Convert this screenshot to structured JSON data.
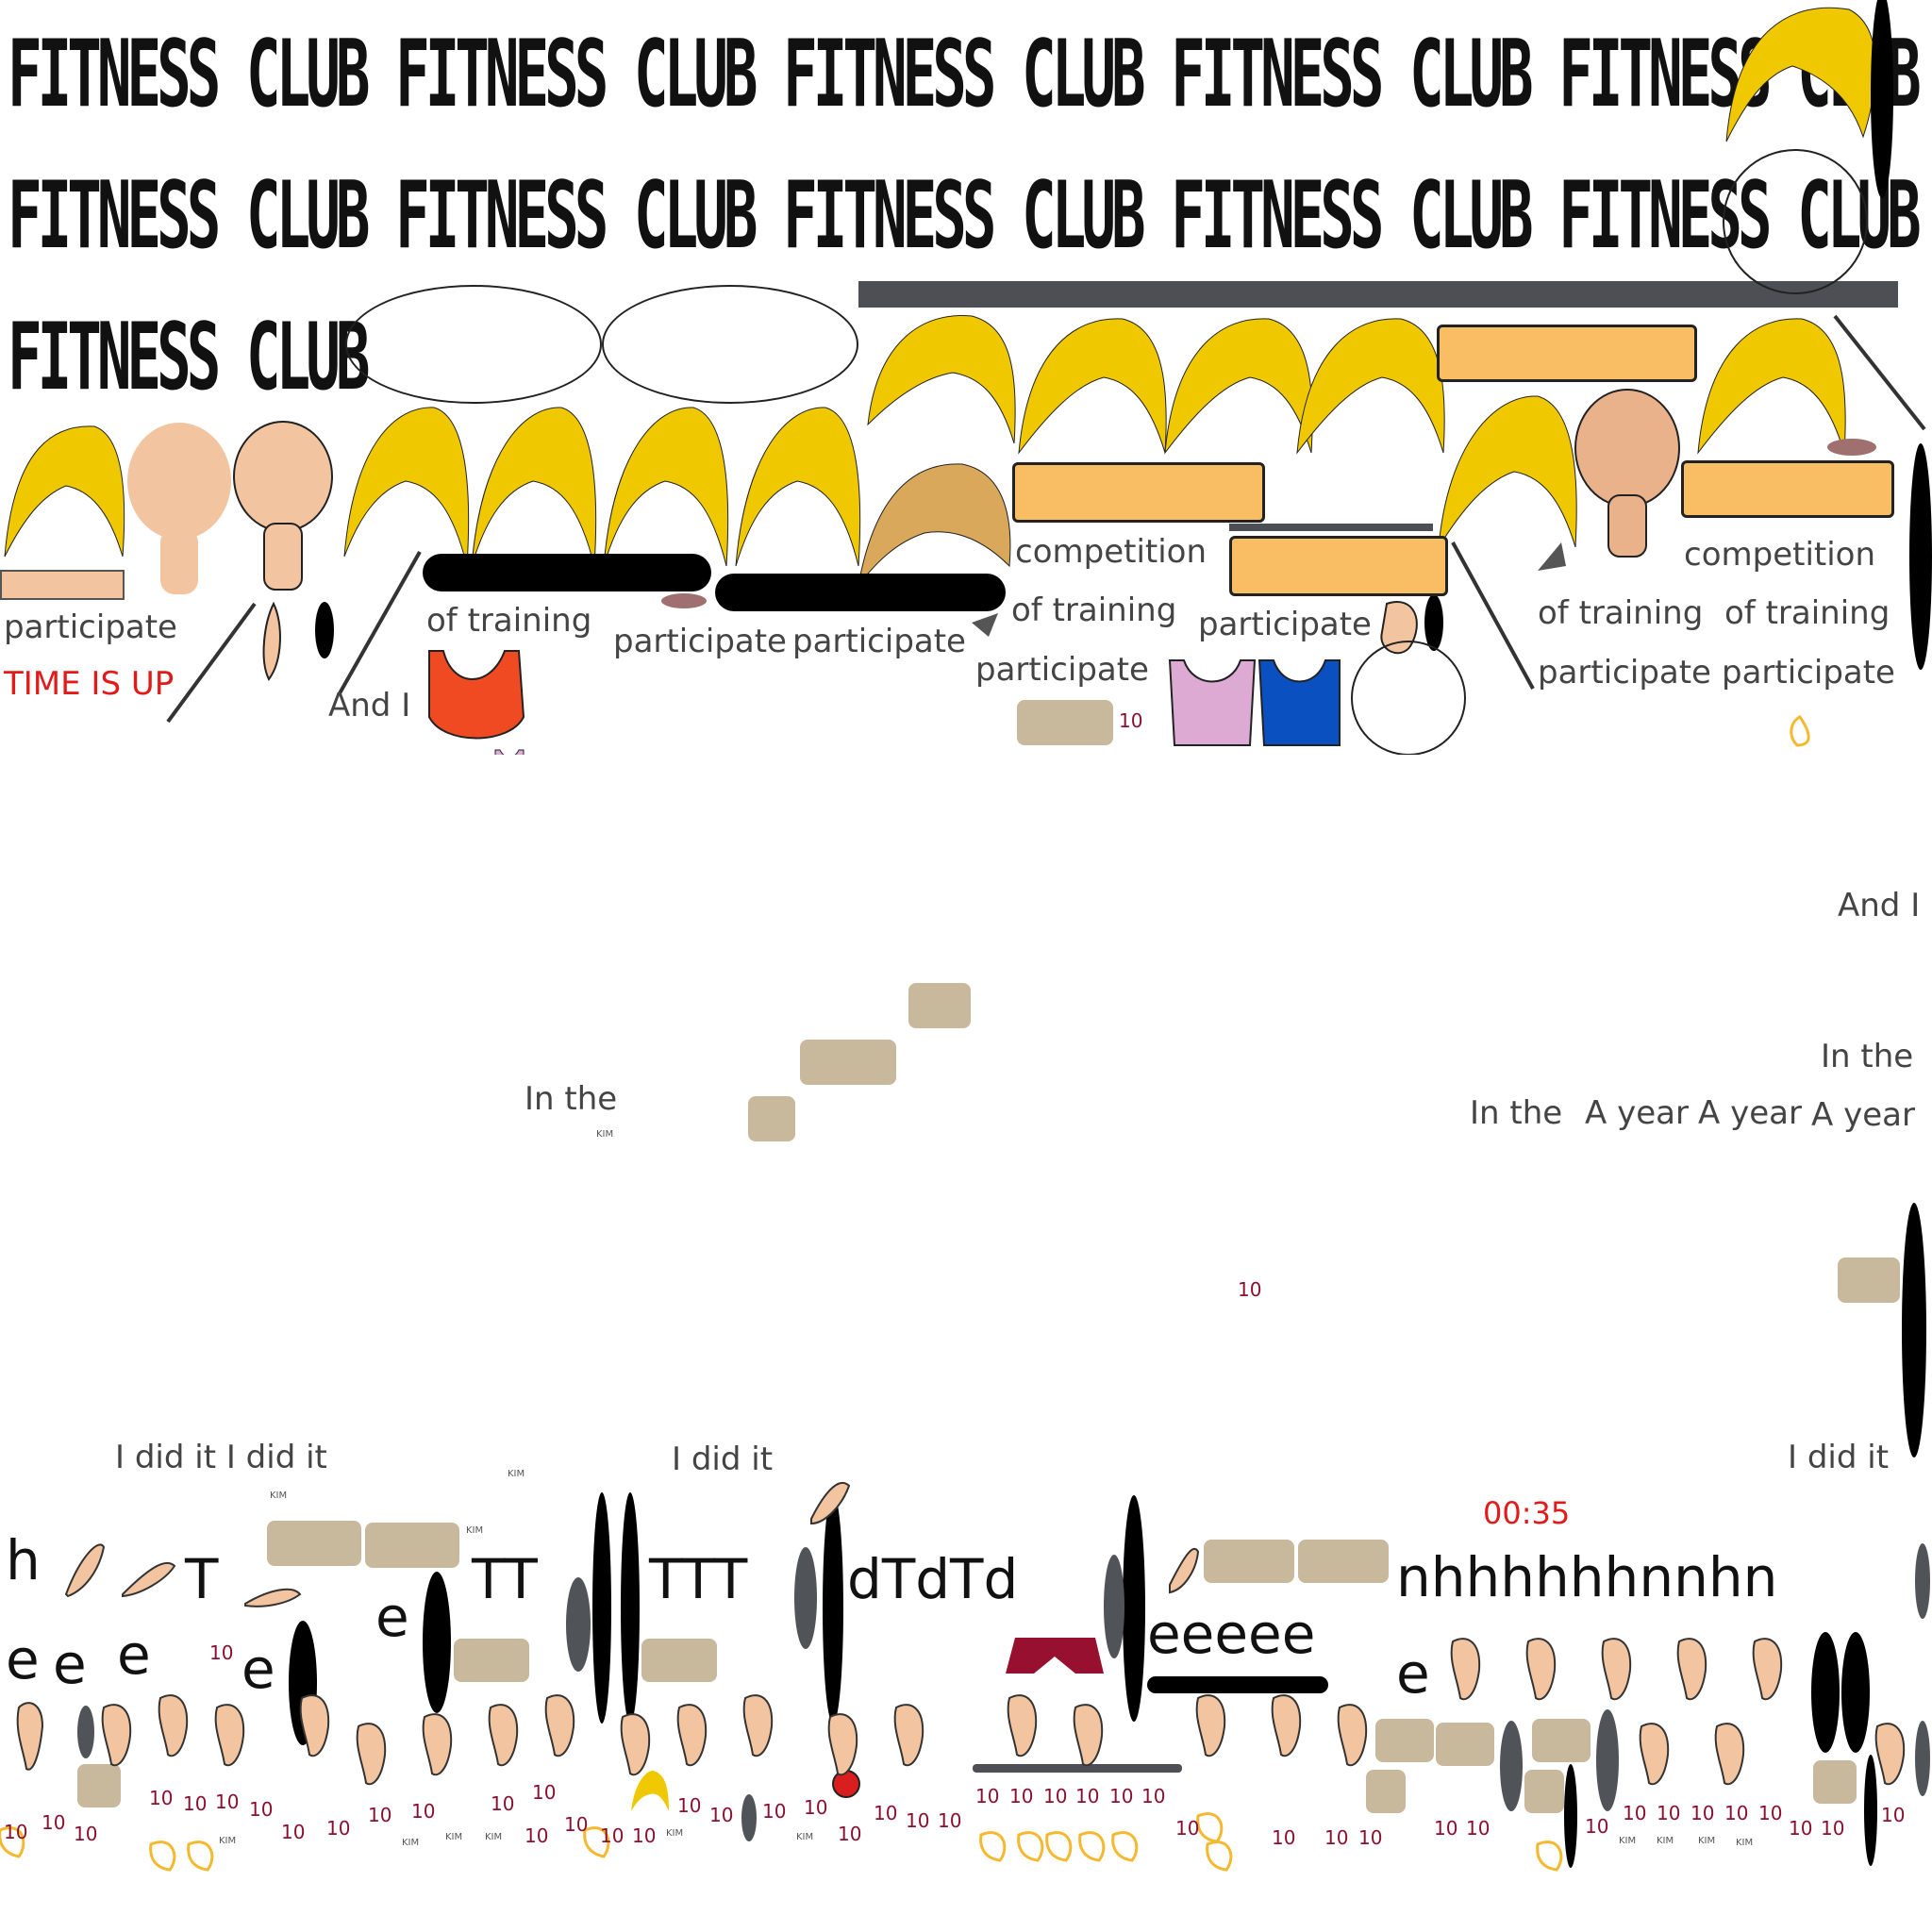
{
  "title": {
    "text": "FITNESS CLUB",
    "row1": "FITNESS CLUB FITNESS CLUB FITNESS CLUB FITNESS CLUB FITNESS CLUB",
    "row2": "FITNESS CLUB FITNESS CLUB FITNESS CLUB FITNESS CLUB FITNESS CLUB",
    "row3": "FITNESS CLUB"
  },
  "hud": {
    "time_up": "TIME IS UP",
    "timer": "00:35"
  },
  "labels": {
    "participate": "participate",
    "of_training": "of training",
    "competition": "competition",
    "and_i": "And I",
    "in_the": "In the",
    "a_year": "A year",
    "i_did_it": "I did it",
    "i_did_it_double": "I did it I did it",
    "ten": "10",
    "kim": "KIM"
  },
  "letters": {
    "h": "h",
    "e": "e",
    "T": "T",
    "d": "d",
    "n": "n",
    "TT": "TT",
    "TTT": "TTT",
    "dTdTd": "dTdTd",
    "eeeee": "eeeee",
    "nhhhhhhnnhn": "nhhhhhhnnhn"
  },
  "colors": {
    "hair_yellow": "#f0c800",
    "hair_tan": "#d9a85a",
    "skin": "#f2c5a0",
    "orange_bar": "#f9bd63",
    "plate": "#c8b99c",
    "dark_bar": "#4d4f54",
    "blue_bar": "#3a78c2",
    "shirt_red": "#f04a22",
    "shirt_pink": "#ddaad3",
    "shirt_blue": "#0a50c0",
    "lips": "#98102f",
    "text_red": "#e21a1a"
  }
}
